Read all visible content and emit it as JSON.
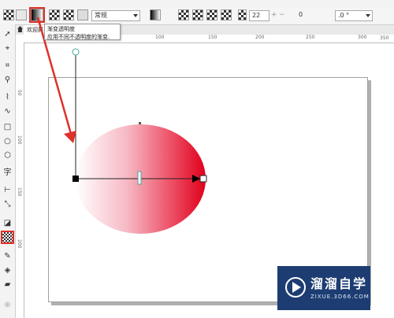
{
  "toolbar": {
    "mode_select": "常规",
    "opacity_value": "22",
    "angle_value": ".0 °",
    "nudge_value": "0"
  },
  "tooltip": {
    "title": "渐变透明度",
    "description": "应用不同不透明度的渐变."
  },
  "tab": {
    "label": "欢迎屏"
  },
  "ruler": {
    "ticks": [
      "100",
      "150",
      "200",
      "250",
      "300",
      "350"
    ],
    "vertical_ticks": [
      "50",
      "100",
      "150",
      "200"
    ]
  },
  "colors": {
    "highlight": "#e0302a",
    "ellipse_end": "#e0001a",
    "watermark_bg": "#1d3d72"
  },
  "watermark": {
    "name": "溜溜自学",
    "url": "ZIXUE.3D66.COM"
  }
}
